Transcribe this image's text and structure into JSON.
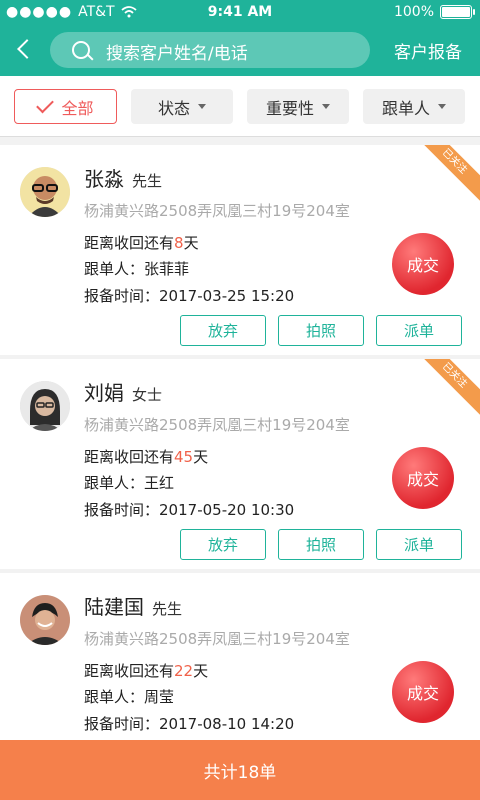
{
  "status": {
    "carrier": "AT&T",
    "time": "9:41 AM",
    "battery": "100%"
  },
  "header": {
    "search_placeholder": "搜索客户姓名/电话",
    "report_label": "客户报备"
  },
  "filters": [
    {
      "label": "全部",
      "active": true
    },
    {
      "label": "状态"
    },
    {
      "label": "重要性"
    },
    {
      "label": "跟单人"
    }
  ],
  "labels": {
    "days_prefix": "距离收回还有",
    "days_suffix": "天",
    "follower_prefix": "跟单人：",
    "time_prefix": "报备时间：",
    "deal": "成交",
    "abandon": "放弃",
    "photo": "拍照",
    "dispatch": "派单",
    "followed_tag": "已关注"
  },
  "customers": [
    {
      "name": "张淼",
      "salutation": "先生",
      "address": "杨浦黄兴路2508弄凤凰三村19号204室",
      "days": "8",
      "follower": "张菲菲",
      "time": "2017-03-25 15:20",
      "followed": true
    },
    {
      "name": "刘娟",
      "salutation": "女士",
      "address": "杨浦黄兴路2508弄凤凰三村19号204室",
      "days": "45",
      "follower": "王红",
      "time": "2017-05-20 10:30",
      "followed": true
    },
    {
      "name": "陆建国",
      "salutation": "先生",
      "address": "杨浦黄兴路2508弄凤凰三村19号204室",
      "days": "22",
      "follower": "周莹",
      "time": "2017-08-10 14:20",
      "followed": false
    }
  ],
  "footer": {
    "total": "共计18单"
  },
  "colors": {
    "brand": "#1fb39a",
    "accent": "#ef5b5b",
    "footer": "#f5804b",
    "days": "#f0624a"
  }
}
